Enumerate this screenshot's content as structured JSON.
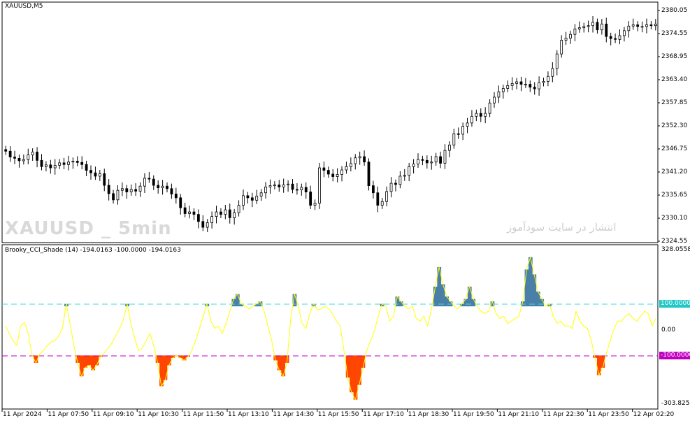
{
  "main_chart": {
    "symbol_label": "XAUUSD,M5",
    "watermark_text": "XAUUSD _ 5min",
    "watermark_persian": "انتشار در سایت سودآموز",
    "price_ticks": [
      "2380.05",
      "2374.55",
      "2368.95",
      "2363.40",
      "2357.85",
      "2352.30",
      "2346.75",
      "2341.20",
      "2335.65",
      "2330.10",
      "2324.55"
    ]
  },
  "indicator": {
    "title": "Brooky_CCI_Shade (14) -194.0163 -100.0000 -194.0163",
    "scale_top": "328.0558",
    "scale_bottom": "-303.8254",
    "zero_label": "0.00",
    "upper_level_label": "100.0000",
    "lower_level_label": "-100.0000"
  },
  "time_axis": [
    "11 Apr 2024",
    "11 Apr 07:50",
    "11 Apr 09:10",
    "11 Apr 10:30",
    "11 Apr 11:50",
    "11 Apr 13:10",
    "11 Apr 14:30",
    "11 Apr 15:50",
    "11 Apr 17:10",
    "11 Apr 18:30",
    "11 Apr 19:50",
    "11 Apr 21:10",
    "11 Apr 22:30",
    "11 Apr 23:50",
    "12 Apr 02:20"
  ],
  "colors": {
    "bull_fill": "#4a7fa8",
    "bear_fill": "#ff4500",
    "cci_line": "#ffff00",
    "upper_level": "#40d8d8",
    "lower_level": "#c000c0",
    "upper_tag_bg": "#20c8c8",
    "lower_tag_bg": "#c000c0"
  },
  "chart_data": [
    {
      "type": "candlestick",
      "title": "XAUUSD,M5",
      "ylim": [
        2324.55,
        2380.05
      ],
      "series": [
        {
          "name": "XAUUSD,M5",
          "values": [
            2346.2,
            2344.8,
            2344.5,
            2343.9,
            2344.2,
            2345.3,
            2346.0,
            2344.0,
            2342.5,
            2342.9,
            2342.2,
            2342.8,
            2343.4,
            2343.0,
            2343.6,
            2343.8,
            2343.5,
            2343.0,
            2341.6,
            2341.0,
            2340.2,
            2340.8,
            2338.0,
            2336.0,
            2334.5,
            2336.8,
            2337.2,
            2336.4,
            2337.0,
            2336.6,
            2337.8,
            2339.7,
            2339.5,
            2338.0,
            2337.4,
            2337.8,
            2337.2,
            2335.9,
            2335.0,
            2332.6,
            2331.2,
            2331.6,
            2331.0,
            2329.3,
            2327.9,
            2329.0,
            2330.5,
            2331.6,
            2331.0,
            2332.1,
            2330.2,
            2331.4,
            2333.2,
            2335.5,
            2335.0,
            2334.4,
            2335.4,
            2336.2,
            2337.6,
            2337.9,
            2338.1,
            2337.6,
            2338.1,
            2338.3,
            2337.0,
            2336.9,
            2337.5,
            2336.4,
            2333.2,
            2333.7,
            2342.2,
            2341.6,
            2340.7,
            2340.1,
            2340.6,
            2341.7,
            2342.5,
            2343.2,
            2344.6,
            2344.9,
            2343.6,
            2337.9,
            2336.2,
            2333.2,
            2334.1,
            2336.5,
            2338.5,
            2338.2,
            2340.2,
            2340.4,
            2342.5,
            2343.1,
            2344.2,
            2344.0,
            2343.4,
            2343.6,
            2344.9,
            2343.3,
            2346.4,
            2347.7,
            2350.4,
            2350.3,
            2352.2,
            2353.0,
            2354.6,
            2355.3,
            2354.6,
            2355.3,
            2357.8,
            2359.2,
            2360.5,
            2361.3,
            2362.0,
            2362.5,
            2362.9,
            2362.3,
            2362.3,
            2361.6,
            2361.2,
            2362.7,
            2363.0,
            2364.2,
            2366.1,
            2369.6,
            2372.9,
            2373.4,
            2374.3,
            2375.6,
            2375.9,
            2376.2,
            2376.4,
            2377.2,
            2375.4,
            2376.8,
            2373.8,
            2373.3,
            2373.1,
            2374.0,
            2375.2,
            2376.3,
            2376.6,
            2376.2,
            2376.2,
            2376.6,
            2376.4,
            2376.8
          ]
        }
      ]
    },
    {
      "type": "bar",
      "title": "Brooky_CCI_Shade (14) -194.0163 -100.0000 -194.0163",
      "ylim": [
        -303.8254,
        328.0558
      ],
      "series": [
        {
          "name": "Brooky_CCI_Shade (14)",
          "values": [
            20,
            -10,
            -40,
            -60,
            20,
            35,
            -10,
            -100,
            -130,
            -95,
            -80,
            -60,
            -45,
            -40,
            -20,
            10,
            110,
            30,
            -60,
            -130,
            -185,
            -150,
            -140,
            -160,
            -140,
            -105,
            -90,
            -70,
            -50,
            -20,
            10,
            45,
            110,
            30,
            -30,
            -80,
            -70,
            -40,
            -10,
            -60,
            -130,
            -225,
            -200,
            -140,
            -110,
            -100,
            -110,
            -120,
            -105,
            -80,
            -40,
            10,
            60,
            110,
            40,
            10,
            20,
            -10,
            30,
            80,
            130,
            150,
            110,
            100,
            90,
            100,
            110,
            120,
            80,
            20,
            -40,
            -120,
            -160,
            -185,
            -130,
            50,
            150,
            100,
            30,
            10,
            70,
            110,
            85,
            90,
            100,
            90,
            70,
            40,
            20,
            -80,
            -190,
            -250,
            -280,
            -220,
            -150,
            -80,
            -40,
            0,
            60,
            110,
            100,
            40,
            60,
            140,
            120,
            100,
            90,
            100,
            50,
            40,
            60,
            20,
            90,
            180,
            260,
            190,
            140,
            120,
            100,
            90,
            110,
            130,
            180,
            130,
            100,
            80,
            70,
            80,
            120,
            70,
            50,
            60,
            30,
            40,
            50,
            60,
            120,
            250,
            300,
            230,
            160,
            130,
            100,
            110,
            60,
            30,
            40,
            20,
            20,
            10,
            80,
            40,
            20,
            10,
            -40,
            -110,
            -180,
            -150,
            -90,
            -40,
            10,
            40,
            40,
            60,
            70,
            50,
            40,
            60,
            80,
            70,
            20,
            50
          ]
        }
      ]
    }
  ]
}
